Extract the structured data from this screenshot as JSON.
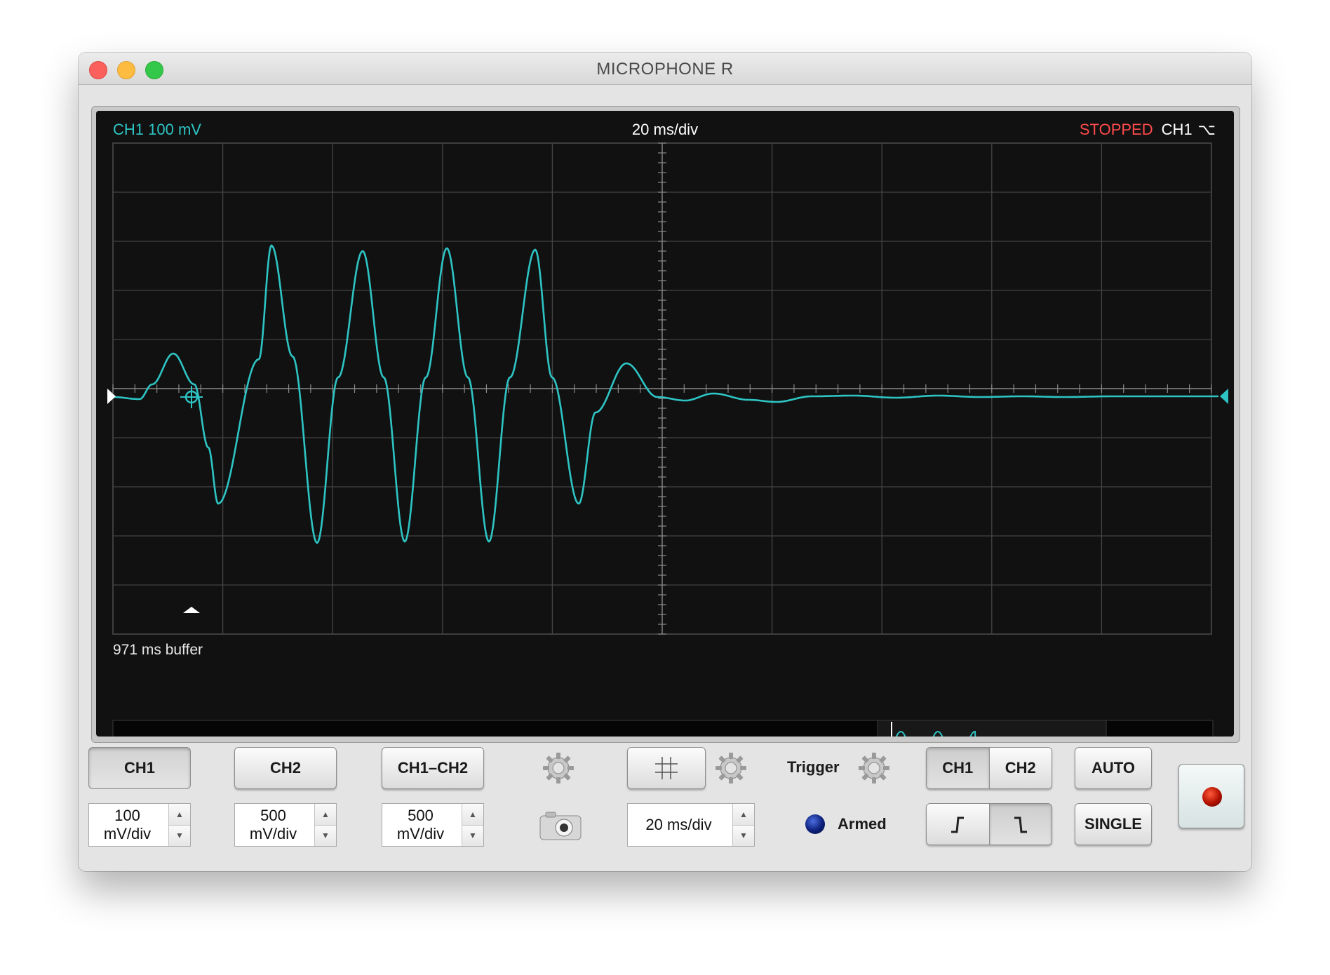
{
  "window": {
    "title": "MICROPHONE R"
  },
  "scope": {
    "ch1_label": "CH1 100 mV",
    "timebase_label": "20 ms/div",
    "status": "STOPPED",
    "trigger_channel": "CH1",
    "trigger_slope_glyph": "⌥",
    "buffer_label": "971 ms buffer",
    "trace_color": "#2ec4c4",
    "status_color": "#ff4b4b"
  },
  "controls": {
    "channels": {
      "ch1": "CH1",
      "ch2": "CH2",
      "diff": "CH1–CH2"
    },
    "volts_per_div": {
      "ch1": "100 mV/div",
      "ch2": "500 mV/div",
      "diff": "500 mV/div"
    },
    "time_per_div": "20 ms/div",
    "trigger_label": "Trigger",
    "trigger_source": {
      "ch1": "CH1",
      "ch2": "CH2"
    },
    "trigger_slope": {
      "rising": "⨍",
      "falling": "⌥"
    },
    "armed_label": "Armed",
    "auto_label": "AUTO",
    "single_label": "SINGLE"
  },
  "icons": {
    "settings_gear": "gear-icon",
    "camera": "camera-icon",
    "grid_toggle": "grid-icon",
    "record": "record-icon"
  }
}
